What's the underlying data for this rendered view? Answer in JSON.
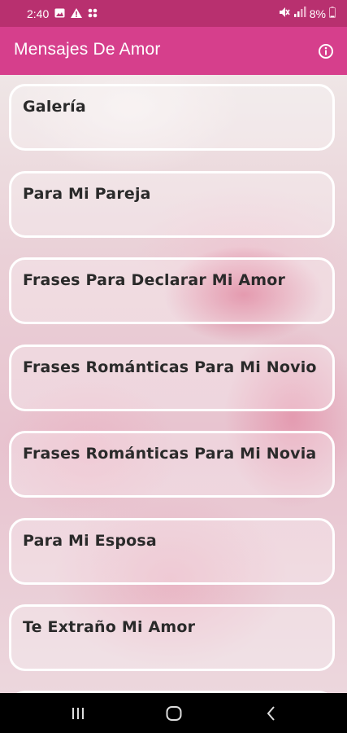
{
  "status_bar": {
    "time": "2:40",
    "battery": "8%",
    "left_icons": [
      "image-icon",
      "alert-icon",
      "grid-icon"
    ],
    "right_icons": [
      "mute-icon",
      "signal-icon",
      "battery-icon"
    ]
  },
  "app_bar": {
    "title": "Mensajes De Amor",
    "action_icon": "info-icon"
  },
  "menu": {
    "items": [
      {
        "label": "Galería"
      },
      {
        "label": "Para Mi Pareja"
      },
      {
        "label": "Frases Para Declarar Mi Amor"
      },
      {
        "label": "Frases Románticas Para Mi Novio"
      },
      {
        "label": "Frases Románticas Para Mi Novia"
      },
      {
        "label": "Para Mi Esposa"
      },
      {
        "label": "Te Extraño Mi Amor"
      }
    ]
  },
  "nav_bar": {
    "buttons": [
      "recents-icon",
      "home-icon",
      "back-icon"
    ]
  },
  "colors": {
    "status_bar": "#b8306f",
    "app_bar": "#d63f8c",
    "item_border": "#ffffff",
    "item_text": "#2a2a2a"
  }
}
